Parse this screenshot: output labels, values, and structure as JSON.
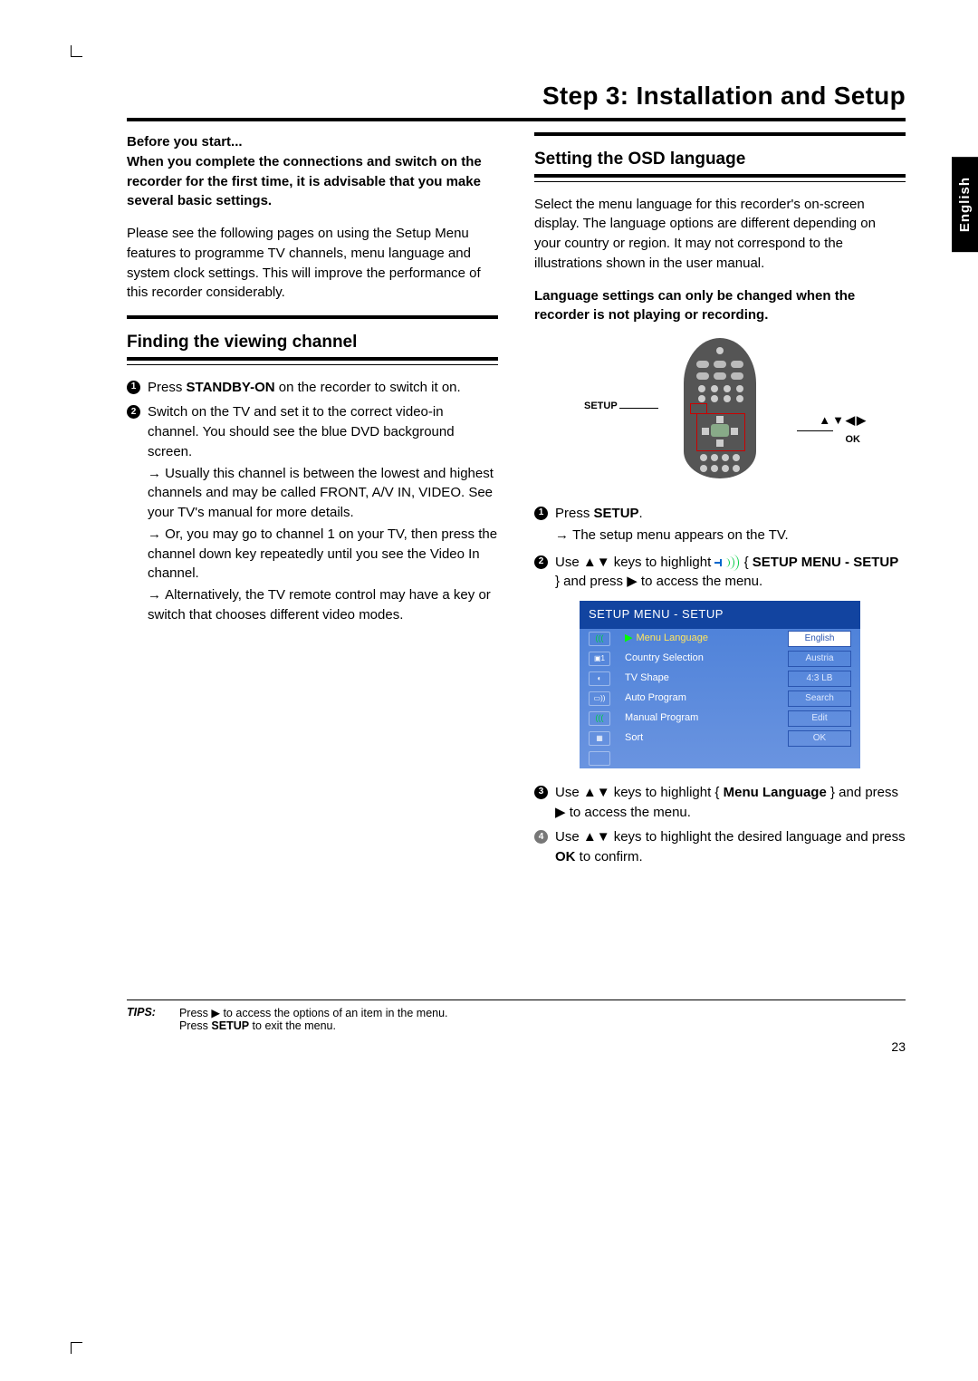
{
  "title": "Step 3: Installation and Setup",
  "side_tab": "English",
  "left": {
    "intro_bold": "Before you start...\nWhen you complete the connections and switch on the recorder for the first time, it is advisable that you make several basic settings.",
    "intro_para": "Please see the following pages on using the Setup Menu features to programme TV channels, menu language and system clock settings. This will improve the performance of this recorder considerably.",
    "section_title": "Finding the viewing channel",
    "items": [
      {
        "n": "1",
        "body": "Press <b>STANDBY-ON</b> on the recorder to switch it on."
      },
      {
        "n": "2",
        "body": "Switch on the TV and set it to the correct video-in channel. You should see the blue DVD background screen.",
        "arrows": [
          "Usually this channel is between the lowest and highest channels and may be called FRONT, A/V IN, VIDEO. See your TV's manual for more details.",
          "Or, you may go to channel 1 on your TV, then press the channel down key repeatedly until you see the Video In channel.",
          "Alternatively, the TV remote control may have a key or switch that chooses different video modes."
        ]
      }
    ]
  },
  "right": {
    "section_title": "Setting the OSD language",
    "para1": "Select the menu language for this recorder's on-screen display.  The language options are different depending on your country or region.  It may not correspond to the illustrations shown in the user manual.",
    "bold_note": "Language settings can only be changed when the recorder is not playing or recording.",
    "remote_labels": {
      "setup": "SETUP",
      "ok": "OK",
      "arrows": "▲▼◀▶"
    },
    "items": [
      {
        "n": "1",
        "body": "Press <b>SETUP</b>.",
        "arrows": [
          "The setup menu appears on the TV."
        ]
      },
      {
        "n": "2",
        "body": "Use ▲▼ keys to highlight <span class='slider-icon'><span class='arc1'></span><span class='arc2'></span><span class='arc3'></span></span> { <b>SETUP MENU - SETUP</b> } and press ▶ to access the menu."
      },
      {
        "n": "3",
        "body": "Use ▲▼ keys to highlight { <b>Menu Language</b> } and press ▶ to access the menu."
      },
      {
        "n": "4",
        "grey": true,
        "body": "Use ▲▼ keys to highlight the desired language and press <b>OK</b> to confirm."
      }
    ],
    "osd": {
      "header": "SETUP MENU - SETUP",
      "rows": [
        {
          "label": "Menu Language",
          "value": "English",
          "sel": true
        },
        {
          "label": "Country Selection",
          "value": "Austria"
        },
        {
          "label": "TV Shape",
          "value": "4:3 LB"
        },
        {
          "label": "Auto Program",
          "value": "Search"
        },
        {
          "label": "Manual Program",
          "value": "Edit"
        },
        {
          "label": "Sort",
          "value": "OK"
        }
      ]
    }
  },
  "tips": {
    "label": "TIPS:",
    "line1": "Press ▶ to access the options of an item in the menu.",
    "line2": "Press <b>SETUP</b> to exit the menu."
  },
  "page_number": "23"
}
